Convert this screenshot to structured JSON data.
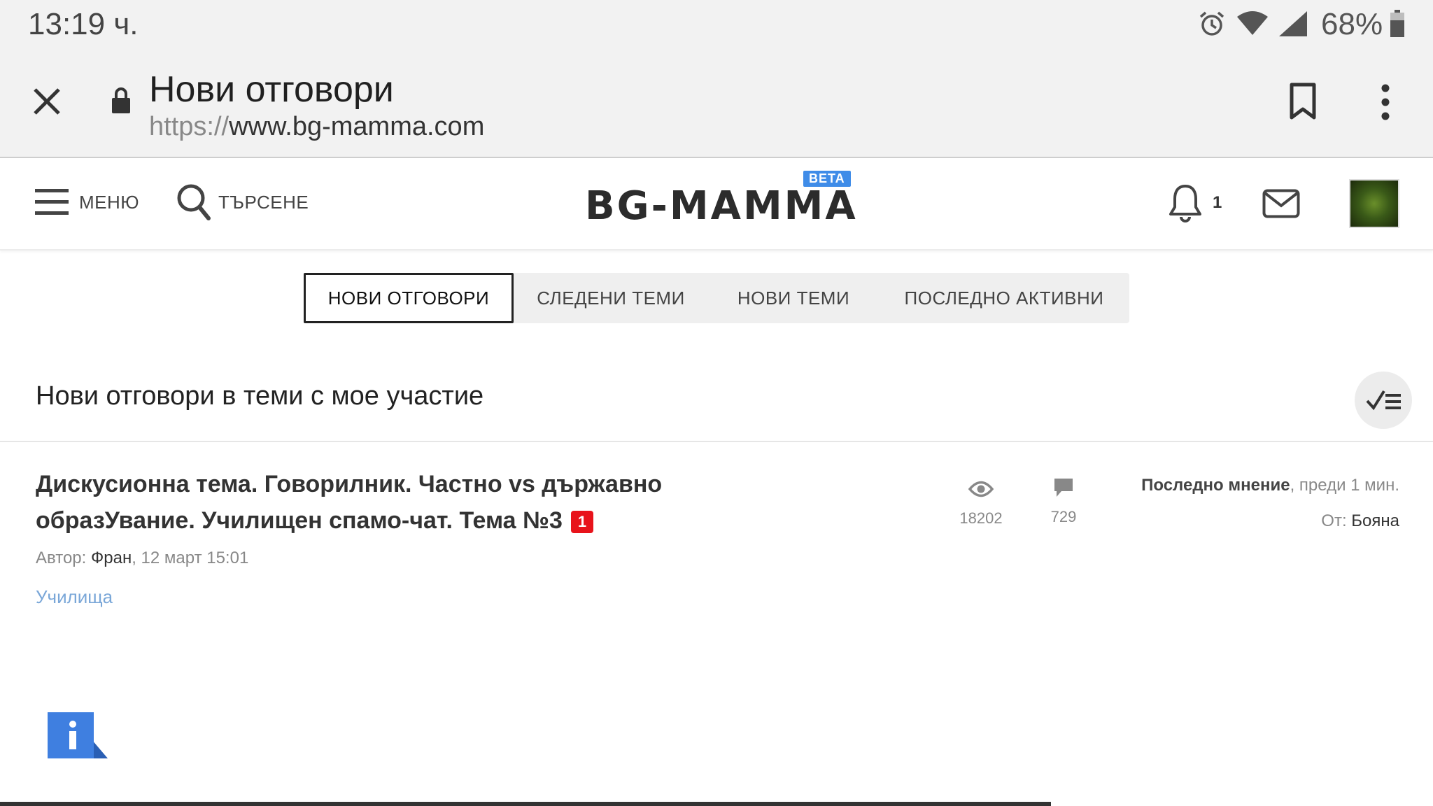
{
  "status_bar": {
    "time": "13:19 ч.",
    "battery_percent": "68%",
    "icons": [
      "alarm-icon",
      "wifi-icon",
      "signal-icon",
      "battery-icon"
    ]
  },
  "browser": {
    "title": "Нови отговори",
    "url_scheme": "https://",
    "url_host": "www.bg-mamma.com"
  },
  "site_header": {
    "menu_label": "МЕНЮ",
    "search_label": "ТЪРСЕНЕ",
    "logo_text": "BG-MAMMA",
    "beta_label": "BETA",
    "notification_count": "1"
  },
  "tabs": [
    {
      "label": "НОВИ ОТГОВОРИ",
      "active": true
    },
    {
      "label": "СЛЕДЕНИ ТЕМИ",
      "active": false
    },
    {
      "label": "НОВИ ТЕМИ",
      "active": false
    },
    {
      "label": "ПОСЛЕДНО АКТИВНИ",
      "active": false
    }
  ],
  "section": {
    "title": "Нови отговори в теми с мое участие"
  },
  "topics": [
    {
      "title": "Дискусионна тема. Говорилник. Частно vs държавно образУвание. Училищен спамо-чат. Тема №3",
      "new_count": "1",
      "author_prefix": "Автор:",
      "author": "Фран",
      "date": ", 12 март 15:01",
      "category": "Училища",
      "views": "18202",
      "replies": "729",
      "last_post_label": "Последно мнение",
      "last_post_time": ", преди 1 мин.",
      "from_prefix": "От:",
      "from_user": "Бояна"
    }
  ],
  "colors": {
    "accent_blue": "#3f8ce8",
    "badge_red": "#e8131b",
    "category_link": "#7aa7d8"
  }
}
